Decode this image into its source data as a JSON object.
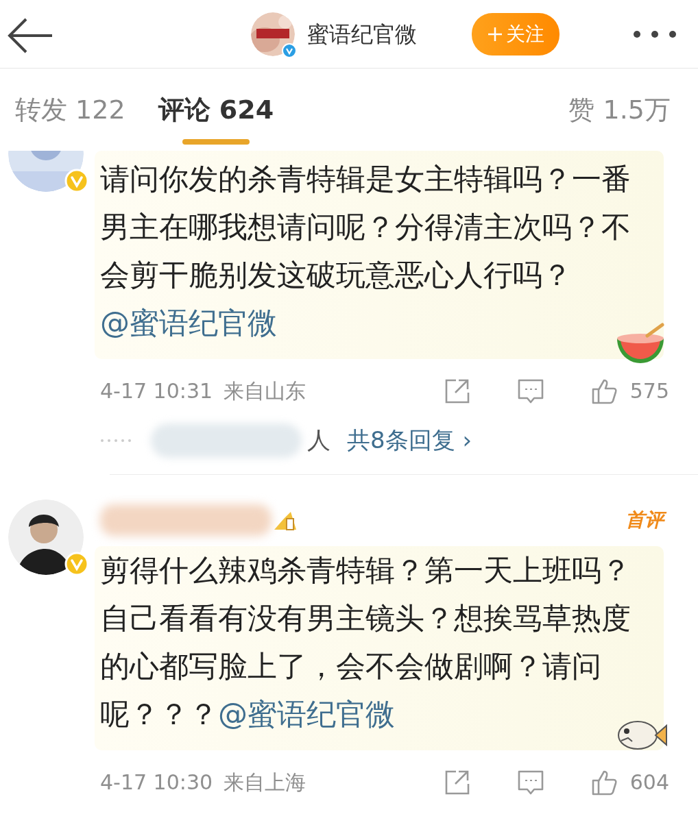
{
  "header": {
    "account_name": "蜜语纪官微",
    "verified": true,
    "follow_button": "关注"
  },
  "tabs": [
    {
      "label": "转发 122",
      "selected": false
    },
    {
      "label": "评论 624",
      "selected": true
    }
  ],
  "likes_total": "赞 1.5万",
  "comments": [
    {
      "verified": true,
      "text": "请问你发的杀青特辑是女主特辑吗？一番男主在哪我想请问呢？分得清主次吗？不会剪干脆别发这破玩意恶心人行吗？",
      "mention": "@蜜语纪官微",
      "time": "4-17 10:31",
      "location": "来自山东",
      "likes": "575",
      "replies": {
        "suffix": "人",
        "link": "共8条回复",
        "arrow": "›"
      }
    },
    {
      "verified": true,
      "badge": "首评",
      "text": "剪得什么辣鸡杀青特辑？第一天上班吗？自己看看有没有男主镜头？想挨骂草热度的心都写脸上了，会不会做剧啊？请问呢？？？",
      "mention": "@蜜语纪官微",
      "time": "4-17 10:30",
      "location": "来自上海",
      "likes": "604"
    }
  ]
}
